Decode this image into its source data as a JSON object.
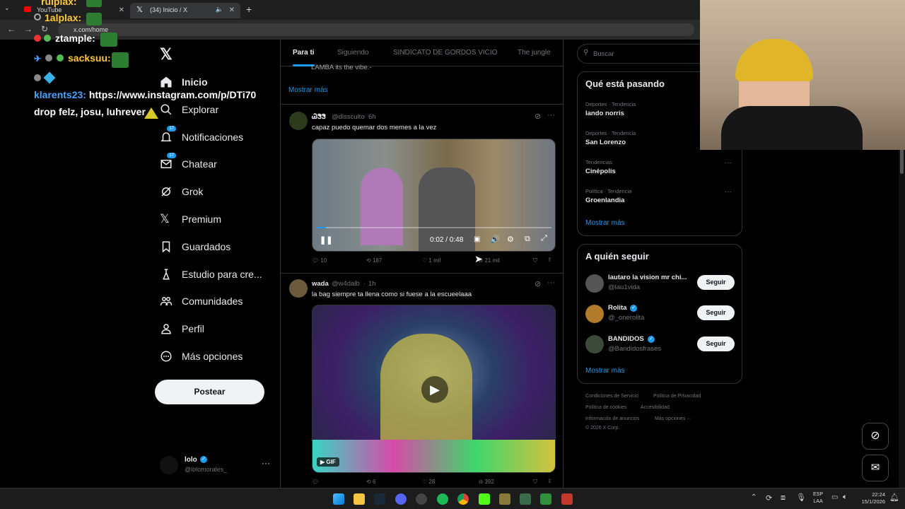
{
  "browser": {
    "tabs": [
      {
        "label": "YouTube"
      },
      {
        "label": "(34) Inicio / X"
      }
    ],
    "url": "x.com/home"
  },
  "chat_overlay": {
    "lines": [
      {
        "user": "rulplax:",
        "text": ""
      },
      {
        "user": "1alplax:",
        "text": ""
      },
      {
        "user": "ztample:",
        "text": ""
      },
      {
        "user": "sacksuu:",
        "text": ""
      },
      {
        "user": "klarents23:",
        "text": "https://www.instagram.com/p/DTi70"
      },
      {
        "user": "",
        "text": "drop felz, josu, luhrever"
      }
    ]
  },
  "nav": {
    "items": [
      {
        "label": "Inicio",
        "icon": "home-icon"
      },
      {
        "label": "Explorar",
        "icon": "search-icon"
      },
      {
        "label": "Notificaciones",
        "icon": "bell-icon",
        "badge": "17"
      },
      {
        "label": "Chatear",
        "icon": "mail-icon",
        "badge": "17"
      },
      {
        "label": "Grok",
        "icon": "grok-icon"
      },
      {
        "label": "Premium",
        "icon": "x-icon"
      },
      {
        "label": "Guardados",
        "icon": "bookmark-icon"
      },
      {
        "label": "Estudio para cre...",
        "icon": "studio-icon"
      },
      {
        "label": "Comunidades",
        "icon": "communities-icon"
      },
      {
        "label": "Perfil",
        "icon": "person-icon"
      },
      {
        "label": "Más opciones",
        "icon": "more-circle-icon"
      }
    ],
    "post_label": "Postear",
    "account": {
      "name": "lolo",
      "handle": "@lolomorales_"
    }
  },
  "feed": {
    "tabs": [
      "Para ti",
      "Siguiendo",
      "SINDICATO DE GORDOS VICIO",
      "The jungle"
    ],
    "top_snippet": "LAMBA its the vibe.-",
    "show_more": "Mostrar más",
    "tweets": [
      {
        "name": "ᏊᏕᏕ",
        "handle": "@dlssculto",
        "time": "6h",
        "text": "capaz puedo quemar dos memes a la vez",
        "video_time": "0:02 / 0:48",
        "replies": "10",
        "reposts": "187",
        "likes": "1 mil",
        "views": "21 mil"
      },
      {
        "name": "wada",
        "handle": "@w4dalb",
        "time": "1h",
        "text": "la bag siempre ta llena como si fuese a la escueelaaa",
        "gif_label": "GIF",
        "replies": "",
        "reposts": "6",
        "likes": "28",
        "views": "392"
      }
    ]
  },
  "sidebar": {
    "search_placeholder": "Buscar",
    "trends_title": "Qué está pasando",
    "trends": [
      {
        "meta": "Deportes · Tendencia",
        "name": "lando norris"
      },
      {
        "meta": "Deportes · Tendencia",
        "name": "San Lorenzo"
      },
      {
        "meta": "Tendencias",
        "name": "Cinépolis"
      },
      {
        "meta": "Política · Tendencia",
        "name": "Groenlandia"
      }
    ],
    "trends_more": "Mostrar más",
    "follow_title": "A quién seguir",
    "follow": [
      {
        "name": "lautaro la vision mr chi...",
        "handle": "@lau1vida",
        "button": "Seguir"
      },
      {
        "name": "Rolita",
        "handle": "@_onerolita",
        "button": "Seguir"
      },
      {
        "name": "BANDIDOS",
        "handle": "@Bandidosfrases",
        "button": "Seguir"
      }
    ],
    "follow_more": "Mostrar más",
    "footer": [
      "Condiciones de Servicio",
      "Política de Privacidad",
      "Política de cookies",
      "Accesibilidad",
      "Información de anuncios",
      "Más opciones ···",
      "© 2026 X Corp."
    ]
  },
  "taskbar": {
    "lang1": "ESP",
    "lang2": "LAA",
    "time": "22:24",
    "date": "15/1/2026"
  }
}
